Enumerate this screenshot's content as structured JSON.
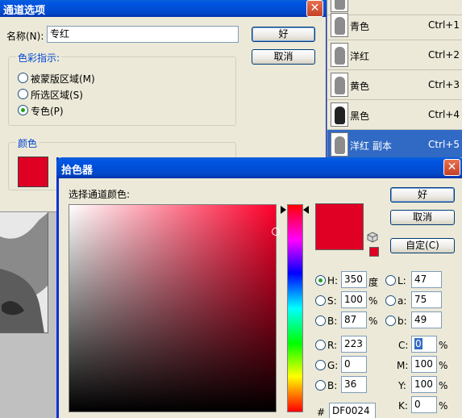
{
  "channel_options": {
    "title": "通道选项",
    "close_glyph": "✕",
    "name_label": "名称(N):",
    "name_value": "专红",
    "ok_label": "好",
    "cancel_label": "取消",
    "group_label": "色彩指示:",
    "options": [
      "被蒙版区域(M)",
      "所选区域(S)",
      "专色(P)"
    ],
    "selected_option": 2,
    "color_group_label": "颜色",
    "color_swatch": "#df0024"
  },
  "channels": [
    {
      "name": "青色",
      "shortcut": "Ctrl+1"
    },
    {
      "name": "洋红",
      "shortcut": "Ctrl+2"
    },
    {
      "name": "黄色",
      "shortcut": "Ctrl+3"
    },
    {
      "name": "黑色",
      "shortcut": "Ctrl+4"
    },
    {
      "name": "洋红 副本",
      "shortcut": "Ctrl+5"
    }
  ],
  "color_picker": {
    "title": "拾色器",
    "close_glyph": "✕",
    "select_label": "选择通道颜色:",
    "ok_label": "好",
    "cancel_label": "取消",
    "custom_label": "自定(C)",
    "hsb": [
      {
        "label": "H:",
        "value": "350",
        "unit": "度"
      },
      {
        "label": "S:",
        "value": "100",
        "unit": "%"
      },
      {
        "label": "B:",
        "value": "87",
        "unit": "%"
      }
    ],
    "lab": [
      {
        "label": "L:",
        "value": "47"
      },
      {
        "label": "a:",
        "value": "75"
      },
      {
        "label": "b:",
        "value": "49"
      }
    ],
    "rgb": [
      {
        "label": "R:",
        "value": "223"
      },
      {
        "label": "G:",
        "value": "0"
      },
      {
        "label": "B:",
        "value": "36"
      }
    ],
    "cmyk": [
      {
        "label": "C:",
        "value": "0",
        "unit": "%"
      },
      {
        "label": "M:",
        "value": "100",
        "unit": "%"
      },
      {
        "label": "Y:",
        "value": "100",
        "unit": "%"
      },
      {
        "label": "K:",
        "value": "0",
        "unit": "%"
      }
    ],
    "hex_label": "#",
    "hex_value": "DF0024",
    "selected_radio": "H",
    "current_color": "#df0024"
  }
}
